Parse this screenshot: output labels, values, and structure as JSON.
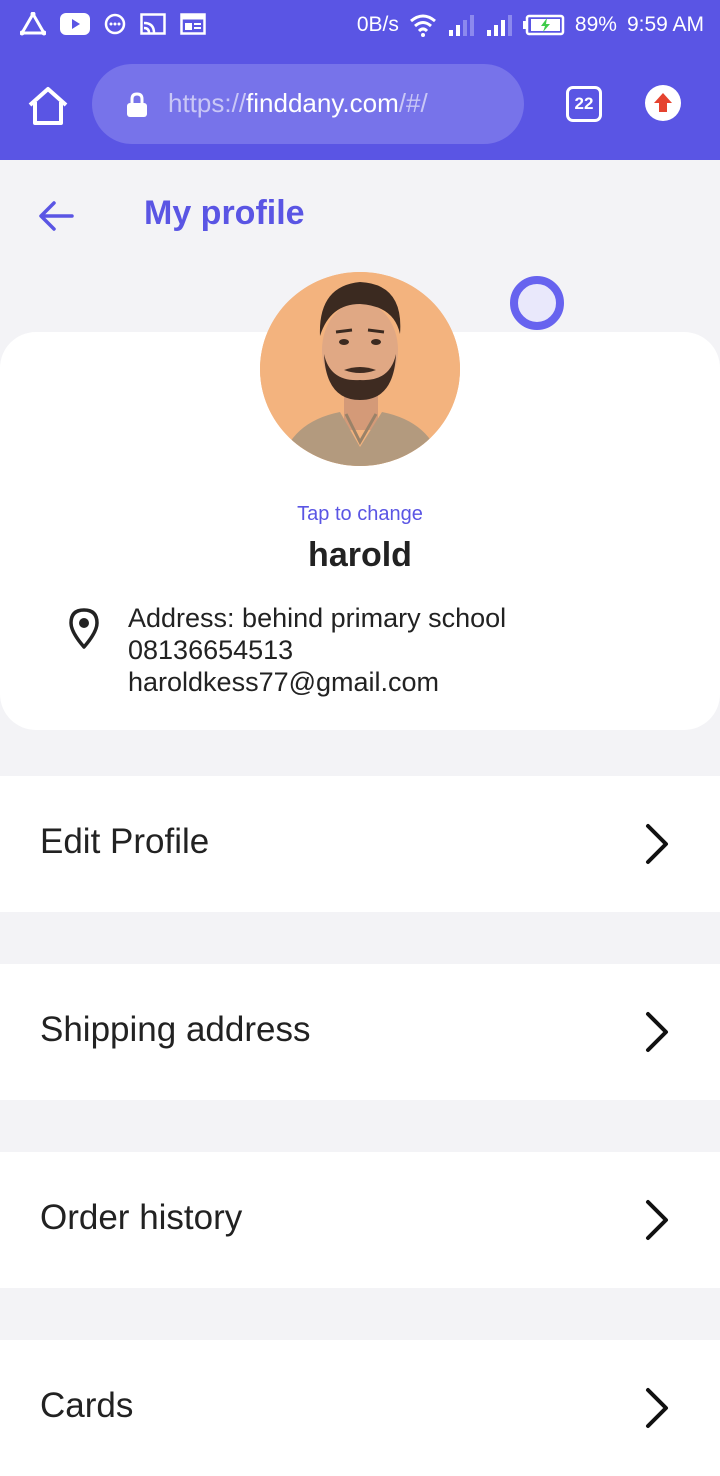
{
  "status_bar": {
    "net_speed": "0B/s",
    "battery": "89%",
    "time": "9:59 AM"
  },
  "browser": {
    "url_scheme": "https://",
    "url_host": "finddany.com",
    "url_path": "/#/",
    "tab_count": "22"
  },
  "header": {
    "title": "My profile"
  },
  "profile": {
    "tap_to_change": "Tap to change",
    "name": "harold",
    "address": "Address: behind primary school",
    "phone": "08136654513",
    "email": "haroldkess77@gmail.com"
  },
  "menu": [
    {
      "label": "Edit Profile"
    },
    {
      "label": "Shipping address"
    },
    {
      "label": "Order history"
    },
    {
      "label": "Cards"
    }
  ],
  "colors": {
    "accent": "#5a55e4",
    "background": "#f3f3f6",
    "card": "#ffffff",
    "upload_arrow": "#e5432f"
  },
  "icons": [
    "home-icon",
    "lock-icon",
    "tabs-icon",
    "upload-icon",
    "back-arrow-icon",
    "location-pin-icon",
    "chevron-right-icon"
  ]
}
